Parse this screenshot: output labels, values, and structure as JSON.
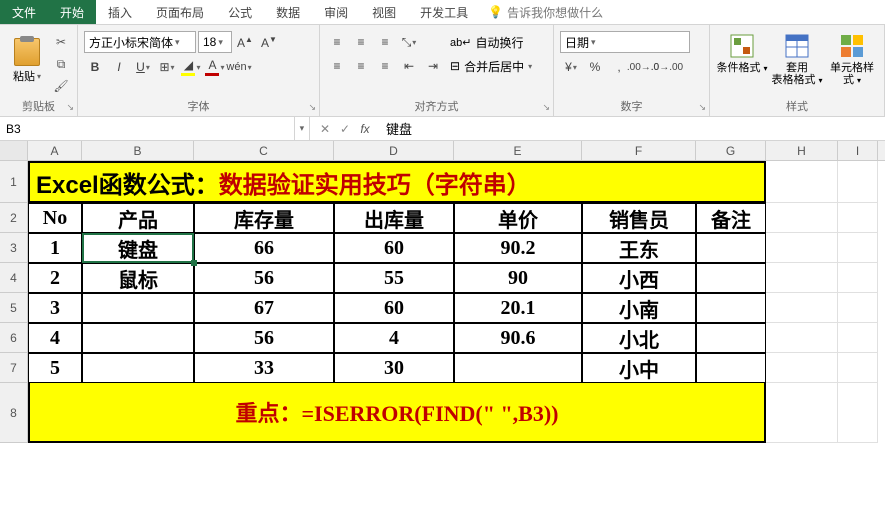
{
  "tabs": {
    "file": "文件",
    "home": "开始",
    "insert": "插入",
    "pageLayout": "页面布局",
    "formulas": "公式",
    "data": "数据",
    "review": "审阅",
    "view": "视图",
    "developer": "开发工具",
    "tellMe": "告诉我你想做什么"
  },
  "ribbon": {
    "clipboard": {
      "paste": "粘贴",
      "label": "剪贴板"
    },
    "font": {
      "name": "方正小标宋简体",
      "size": "18",
      "label": "字体",
      "bold": "B",
      "italic": "I",
      "underline": "U"
    },
    "alignment": {
      "wrap": "自动换行",
      "merge": "合并后居中",
      "label": "对齐方式"
    },
    "number": {
      "format": "日期",
      "label": "数字"
    },
    "styles": {
      "cond": "条件格式",
      "table": "套用\n表格格式",
      "cell": "单元格样式",
      "label": "样式"
    }
  },
  "nameBox": "B3",
  "formulaBar": "键盘",
  "columns": [
    "A",
    "B",
    "C",
    "D",
    "E",
    "F",
    "G",
    "H",
    "I"
  ],
  "sheet": {
    "title": {
      "left": "Excel函数公式：",
      "right": "数据验证实用技巧（字符串）"
    },
    "headers": [
      "No",
      "产品",
      "库存量",
      "出库量",
      "单价",
      "销售员",
      "备注"
    ],
    "rows": [
      {
        "no": "1",
        "prod": "键盘",
        "stock": "66",
        "out": "60",
        "price": "90.2",
        "sales": "王东",
        "note": ""
      },
      {
        "no": "2",
        "prod": "鼠标",
        "stock": "56",
        "out": "55",
        "price": "90",
        "sales": "小西",
        "note": ""
      },
      {
        "no": "3",
        "prod": "",
        "stock": "67",
        "out": "60",
        "price": "20.1",
        "sales": "小南",
        "note": ""
      },
      {
        "no": "4",
        "prod": "",
        "stock": "56",
        "out": "4",
        "price": "90.6",
        "sales": "小北",
        "note": ""
      },
      {
        "no": "5",
        "prod": "",
        "stock": "33",
        "out": "30",
        "price": "",
        "sales": "小中",
        "note": ""
      }
    ],
    "formulaLine": "重点：=ISERROR(FIND(\" \",B3))"
  },
  "colors": {
    "brand": "#217346",
    "yellow": "#ffff00",
    "red": "#c00000"
  }
}
